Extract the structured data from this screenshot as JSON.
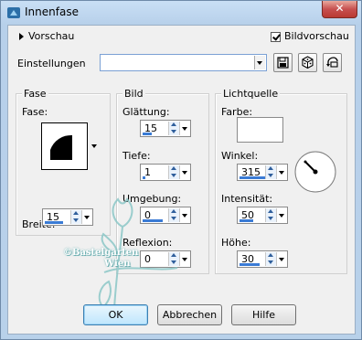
{
  "window": {
    "title": "Innenfase",
    "close_glyph": "✕"
  },
  "preview": {
    "label": "Vorschau",
    "checkbox_label": "Bildvorschau",
    "checked": true
  },
  "settings": {
    "label": "Einstellungen",
    "value": ""
  },
  "fase_panel": {
    "title": "Fase",
    "fase_label": "Fase:",
    "breite_label": "Breite:",
    "breite_value": "15"
  },
  "bild_panel": {
    "title": "Bild",
    "glattung_label": "Glättung:",
    "glattung_value": "15",
    "tiefe_label": "Tiefe:",
    "tiefe_value": "1",
    "umgebung_label": "Umgebung:",
    "umgebung_value": "0",
    "reflexion_label": "Reflexion:",
    "reflexion_value": "0"
  },
  "licht_panel": {
    "title": "Lichtquelle",
    "farbe_label": "Farbe:",
    "farbe_color": "#ffffff",
    "winkel_label": "Winkel:",
    "winkel_value": "315",
    "intensitat_label": "Intensität:",
    "intensitat_value": "50",
    "hohe_label": "Höhe:",
    "hohe_value": "30"
  },
  "buttons": {
    "ok": "OK",
    "cancel": "Abbrechen",
    "help": "Hilfe"
  },
  "watermark": {
    "line1": "©Bastelgarten",
    "line2": "Wien"
  },
  "colors": {
    "accent": "#3a7bd5",
    "title_gradient": "#c9dff5",
    "close": "#c75050"
  }
}
